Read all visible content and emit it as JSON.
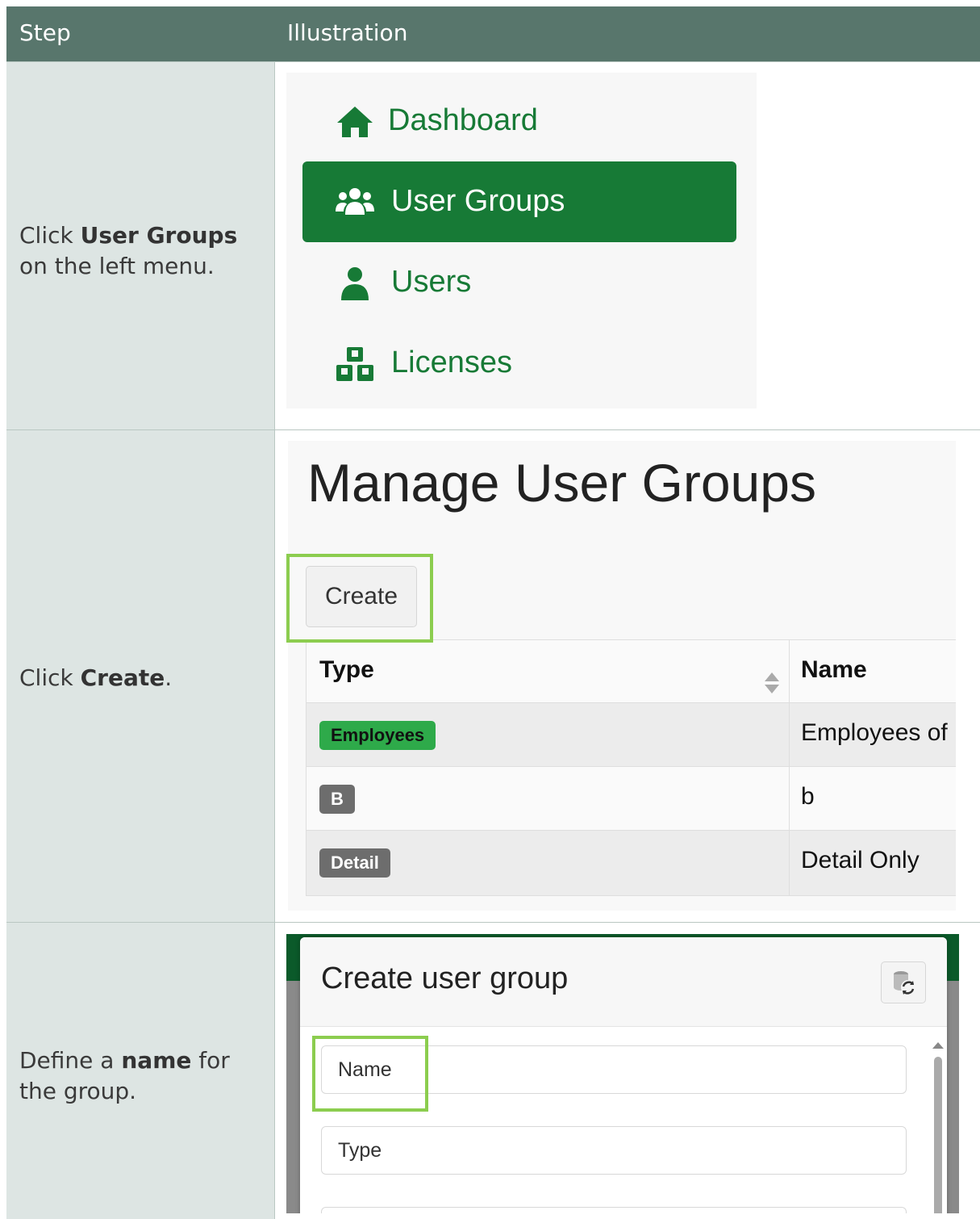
{
  "header": {
    "step": "Step",
    "illustration": "Illustration"
  },
  "colors": {
    "header_bg": "#58766c",
    "step_bg": "#dde5e3",
    "brand_green": "#177a36",
    "highlight": "#8ccd4f"
  },
  "steps": [
    {
      "text_pre": "Click ",
      "text_bold": "User Groups",
      "text_post": " on the left menu.",
      "menu": [
        {
          "label": "Dashboard",
          "icon": "home-icon",
          "active": false
        },
        {
          "label": "User Groups",
          "icon": "users-group-icon",
          "active": true
        },
        {
          "label": "Users",
          "icon": "user-icon",
          "active": false
        },
        {
          "label": "Licenses",
          "icon": "licenses-icon",
          "active": false
        }
      ]
    },
    {
      "text_pre": "Click ",
      "text_bold": "Create",
      "text_post": ".",
      "page_title": "Manage User Groups",
      "create_label": "Create",
      "table": {
        "headers": [
          "Type",
          "Name"
        ],
        "rows": [
          {
            "badge": "Employees",
            "badge_color": "#2eaa4a",
            "name": "Employees of"
          },
          {
            "badge": "B",
            "badge_color": "#6d6d6d",
            "name": "b"
          },
          {
            "badge": "Detail",
            "badge_color": "#6d6d6d",
            "name": "Detail Only"
          }
        ]
      }
    },
    {
      "text_pre": "Define a ",
      "text_bold": "name",
      "text_post": " for the group.",
      "modal_title": "Create user group",
      "fields": [
        "Name",
        "Type"
      ]
    }
  ]
}
